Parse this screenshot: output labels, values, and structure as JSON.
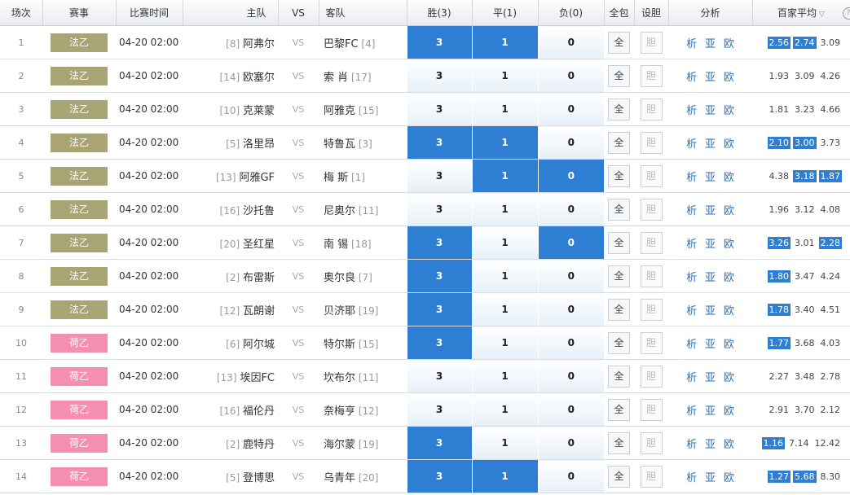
{
  "header": {
    "idx": "场次",
    "league": "赛事",
    "time": "比赛时间",
    "home": "主队",
    "vs": "VS",
    "away": "客队",
    "win": "胜(3)",
    "draw": "平(1)",
    "lose": "负(0)",
    "all_pack": "全包",
    "set_banker": "设胆",
    "analysis": "分析",
    "avg_odds": "百家平均",
    "sort_icon": "▽",
    "help_icon": "?"
  },
  "colors": {
    "ligue2": "#a8a473",
    "eerste": "#f48fb1",
    "selected": "#2e7fd4"
  },
  "rows": [
    {
      "idx": "1",
      "league": "法乙",
      "lt": "ligue2",
      "time": "04-20 02:00",
      "home_rank": "[8]",
      "home": "阿弗尔",
      "vs": "VS",
      "away": "巴黎FC",
      "away_rank": "[4]",
      "win": "3",
      "draw": "1",
      "lose": "0",
      "sel": [
        1,
        1,
        0
      ],
      "all": "全",
      "ban": "胆",
      "a1": "析",
      "a2": "亚",
      "a3": "欧",
      "odds": [
        "2.56",
        "2.74",
        "3.09"
      ],
      "hl": [
        1,
        1,
        0
      ]
    },
    {
      "idx": "2",
      "league": "法乙",
      "lt": "ligue2",
      "time": "04-20 02:00",
      "home_rank": "[14]",
      "home": "欧塞尔",
      "vs": "VS",
      "away": "索 肖",
      "away_rank": "[17]",
      "win": "3",
      "draw": "1",
      "lose": "0",
      "sel": [
        0,
        0,
        0
      ],
      "all": "全",
      "ban": "胆",
      "a1": "析",
      "a2": "亚",
      "a3": "欧",
      "odds": [
        "1.93",
        "3.09",
        "4.26"
      ],
      "hl": [
        0,
        0,
        0
      ]
    },
    {
      "idx": "3",
      "league": "法乙",
      "lt": "ligue2",
      "time": "04-20 02:00",
      "home_rank": "[10]",
      "home": "克莱蒙",
      "vs": "VS",
      "away": "阿雅克",
      "away_rank": "[15]",
      "win": "3",
      "draw": "1",
      "lose": "0",
      "sel": [
        0,
        0,
        0
      ],
      "all": "全",
      "ban": "胆",
      "a1": "析",
      "a2": "亚",
      "a3": "欧",
      "odds": [
        "1.81",
        "3.23",
        "4.66"
      ],
      "hl": [
        0,
        0,
        0
      ]
    },
    {
      "idx": "4",
      "league": "法乙",
      "lt": "ligue2",
      "time": "04-20 02:00",
      "home_rank": "[5]",
      "home": "洛里昂",
      "vs": "VS",
      "away": "特鲁瓦",
      "away_rank": "[3]",
      "win": "3",
      "draw": "1",
      "lose": "0",
      "sel": [
        1,
        1,
        0
      ],
      "all": "全",
      "ban": "胆",
      "a1": "析",
      "a2": "亚",
      "a3": "欧",
      "odds": [
        "2.10",
        "3.00",
        "3.73"
      ],
      "hl": [
        1,
        1,
        0
      ]
    },
    {
      "idx": "5",
      "league": "法乙",
      "lt": "ligue2",
      "time": "04-20 02:00",
      "home_rank": "[13]",
      "home": "阿雅GF",
      "vs": "VS",
      "away": "梅 斯",
      "away_rank": "[1]",
      "win": "3",
      "draw": "1",
      "lose": "0",
      "sel": [
        0,
        1,
        1
      ],
      "all": "全",
      "ban": "胆",
      "a1": "析",
      "a2": "亚",
      "a3": "欧",
      "odds": [
        "4.38",
        "3.18",
        "1.87"
      ],
      "hl": [
        0,
        1,
        1
      ]
    },
    {
      "idx": "6",
      "league": "法乙",
      "lt": "ligue2",
      "time": "04-20 02:00",
      "home_rank": "[16]",
      "home": "沙托鲁",
      "vs": "VS",
      "away": "尼奥尔",
      "away_rank": "[11]",
      "win": "3",
      "draw": "1",
      "lose": "0",
      "sel": [
        0,
        0,
        0
      ],
      "all": "全",
      "ban": "胆",
      "a1": "析",
      "a2": "亚",
      "a3": "欧",
      "odds": [
        "1.96",
        "3.12",
        "4.08"
      ],
      "hl": [
        0,
        0,
        0
      ]
    },
    {
      "idx": "7",
      "league": "法乙",
      "lt": "ligue2",
      "time": "04-20 02:00",
      "home_rank": "[20]",
      "home": "圣红星",
      "vs": "VS",
      "away": "南 锡",
      "away_rank": "[18]",
      "win": "3",
      "draw": "1",
      "lose": "0",
      "sel": [
        1,
        0,
        1
      ],
      "all": "全",
      "ban": "胆",
      "a1": "析",
      "a2": "亚",
      "a3": "欧",
      "odds": [
        "3.26",
        "3.01",
        "2.28"
      ],
      "hl": [
        1,
        0,
        1
      ]
    },
    {
      "idx": "8",
      "league": "法乙",
      "lt": "ligue2",
      "time": "04-20 02:00",
      "home_rank": "[2]",
      "home": "布雷斯",
      "vs": "VS",
      "away": "奥尔良",
      "away_rank": "[7]",
      "win": "3",
      "draw": "1",
      "lose": "0",
      "sel": [
        1,
        0,
        0
      ],
      "all": "全",
      "ban": "胆",
      "a1": "析",
      "a2": "亚",
      "a3": "欧",
      "odds": [
        "1.80",
        "3.47",
        "4.24"
      ],
      "hl": [
        1,
        0,
        0
      ]
    },
    {
      "idx": "9",
      "league": "法乙",
      "lt": "ligue2",
      "time": "04-20 02:00",
      "home_rank": "[12]",
      "home": "瓦朗谢",
      "vs": "VS",
      "away": "贝济耶",
      "away_rank": "[19]",
      "win": "3",
      "draw": "1",
      "lose": "0",
      "sel": [
        1,
        0,
        0
      ],
      "all": "全",
      "ban": "胆",
      "a1": "析",
      "a2": "亚",
      "a3": "欧",
      "odds": [
        "1.78",
        "3.40",
        "4.51"
      ],
      "hl": [
        1,
        0,
        0
      ]
    },
    {
      "idx": "10",
      "league": "荷乙",
      "lt": "eerste",
      "time": "04-20 02:00",
      "home_rank": "[6]",
      "home": "阿尔城",
      "vs": "VS",
      "away": "特尔斯",
      "away_rank": "[15]",
      "win": "3",
      "draw": "1",
      "lose": "0",
      "sel": [
        1,
        0,
        0
      ],
      "all": "全",
      "ban": "胆",
      "a1": "析",
      "a2": "亚",
      "a3": "欧",
      "odds": [
        "1.77",
        "3.68",
        "4.03"
      ],
      "hl": [
        1,
        0,
        0
      ]
    },
    {
      "idx": "11",
      "league": "荷乙",
      "lt": "eerste",
      "time": "04-20 02:00",
      "home_rank": "[13]",
      "home": "埃因FC",
      "vs": "VS",
      "away": "坎布尔",
      "away_rank": "[11]",
      "win": "3",
      "draw": "1",
      "lose": "0",
      "sel": [
        0,
        0,
        0
      ],
      "all": "全",
      "ban": "胆",
      "a1": "析",
      "a2": "亚",
      "a3": "欧",
      "odds": [
        "2.27",
        "3.48",
        "2.78"
      ],
      "hl": [
        0,
        0,
        0
      ]
    },
    {
      "idx": "12",
      "league": "荷乙",
      "lt": "eerste",
      "time": "04-20 02:00",
      "home_rank": "[16]",
      "home": "福伦丹",
      "vs": "VS",
      "away": "奈梅亨",
      "away_rank": "[12]",
      "win": "3",
      "draw": "1",
      "lose": "0",
      "sel": [
        0,
        0,
        0
      ],
      "all": "全",
      "ban": "胆",
      "a1": "析",
      "a2": "亚",
      "a3": "欧",
      "odds": [
        "2.91",
        "3.70",
        "2.12"
      ],
      "hl": [
        0,
        0,
        0
      ]
    },
    {
      "idx": "13",
      "league": "荷乙",
      "lt": "eerste",
      "time": "04-20 02:00",
      "home_rank": "[2]",
      "home": "鹿特丹",
      "vs": "VS",
      "away": "海尔蒙",
      "away_rank": "[19]",
      "win": "3",
      "draw": "1",
      "lose": "0",
      "sel": [
        1,
        0,
        0
      ],
      "all": "全",
      "ban": "胆",
      "a1": "析",
      "a2": "亚",
      "a3": "欧",
      "odds": [
        "1.16",
        "7.14",
        "12.42"
      ],
      "hl": [
        1,
        0,
        0
      ]
    },
    {
      "idx": "14",
      "league": "荷乙",
      "lt": "eerste",
      "time": "04-20 02:00",
      "home_rank": "[5]",
      "home": "登博思",
      "vs": "VS",
      "away": "乌青年",
      "away_rank": "[20]",
      "win": "3",
      "draw": "1",
      "lose": "0",
      "sel": [
        1,
        1,
        0
      ],
      "all": "全",
      "ban": "胆",
      "a1": "析",
      "a2": "亚",
      "a3": "欧",
      "odds": [
        "1.27",
        "5.68",
        "8.30"
      ],
      "hl": [
        1,
        1,
        0
      ]
    }
  ]
}
